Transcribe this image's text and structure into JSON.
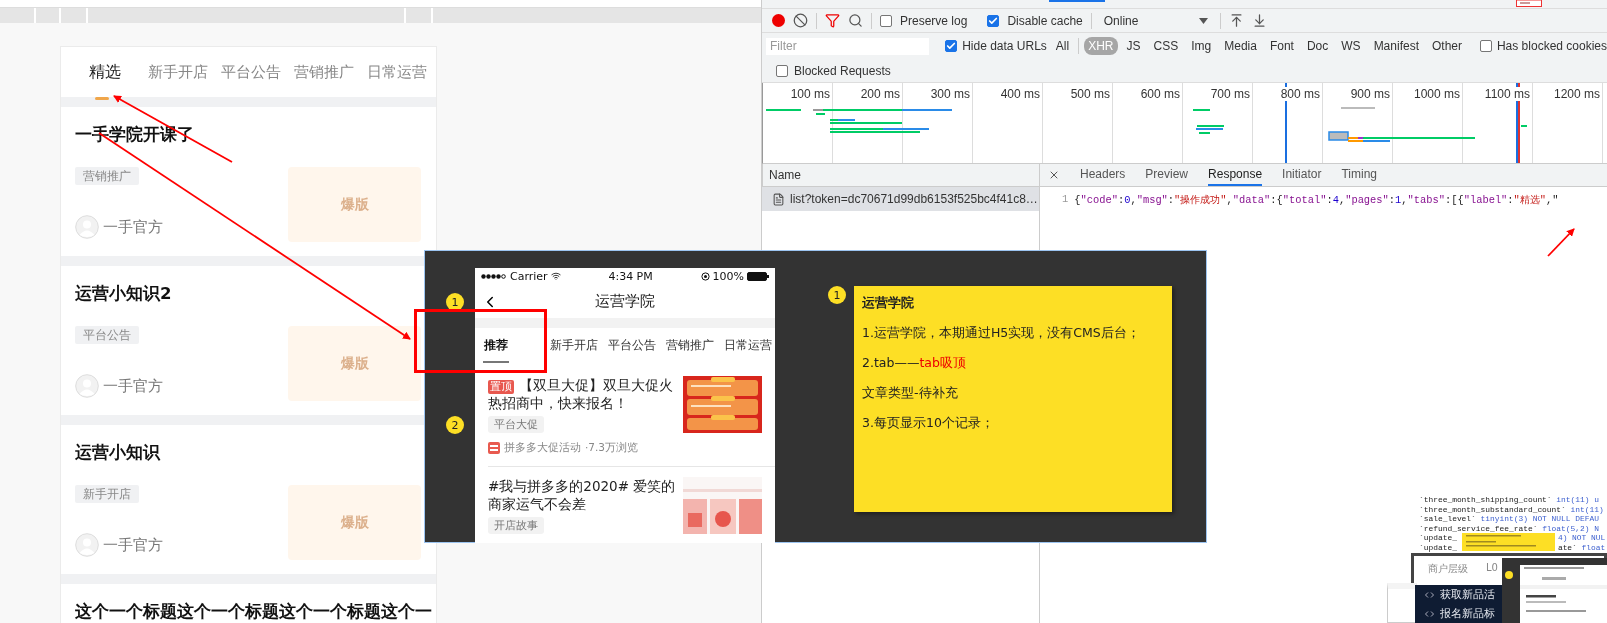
{
  "page": {
    "tabs": [
      {
        "label": "精选",
        "selected": true
      },
      {
        "label": "新手开店",
        "selected": false
      },
      {
        "label": "平台公告",
        "selected": false
      },
      {
        "label": "营销推广",
        "selected": false
      },
      {
        "label": "日常运营",
        "selected": false
      }
    ],
    "articles": [
      {
        "title": "一手学院开课了",
        "tag": "营销推广",
        "author": "一手官方",
        "cover": "爆版"
      },
      {
        "title": "运营小知识2",
        "tag": "平台公告",
        "author": "一手官方",
        "cover": "爆版"
      },
      {
        "title": "运营小知识",
        "tag": "新手开店",
        "author": "一手官方",
        "cover": "爆版"
      },
      {
        "title": "这个一个标题这个一个标题这个一个标题这个一"
      }
    ]
  },
  "devtools": {
    "toolbar": {
      "preserve_log": {
        "label": "Preserve log",
        "checked": false
      },
      "disable_cache": {
        "label": "Disable cache",
        "checked": true
      },
      "throttling": "Online"
    },
    "filter": {
      "placeholder": "Filter",
      "hide_data_urls": {
        "label": "Hide data URLs",
        "checked": true
      },
      "types": [
        {
          "label": "All",
          "selected": false
        },
        {
          "label": "XHR",
          "selected": true
        },
        {
          "label": "JS",
          "selected": false
        },
        {
          "label": "CSS",
          "selected": false
        },
        {
          "label": "Img",
          "selected": false
        },
        {
          "label": "Media",
          "selected": false
        },
        {
          "label": "Font",
          "selected": false
        },
        {
          "label": "Doc",
          "selected": false
        },
        {
          "label": "WS",
          "selected": false
        },
        {
          "label": "Manifest",
          "selected": false
        },
        {
          "label": "Other",
          "selected": false
        }
      ],
      "has_blocked_cookies": {
        "label": "Has blocked cookies",
        "checked": false
      },
      "blocked_requests": {
        "label": "Blocked Requests",
        "checked": false
      }
    },
    "timeline": {
      "ticks": [
        "100 ms",
        "200 ms",
        "300 ms",
        "400 ms",
        "500 ms",
        "600 ms",
        "700 ms",
        "800 ms",
        "900 ms",
        "1000 ms",
        "1100 ms",
        "1200 ms"
      ]
    },
    "requests": {
      "header": "Name",
      "rows": [
        {
          "name": "list?token=dc70671d99db6153f525bc4f41c8…",
          "selected": true
        }
      ]
    },
    "details": {
      "tabs": [
        {
          "label": "Headers",
          "selected": false
        },
        {
          "label": "Preview",
          "selected": false
        },
        {
          "label": "Response",
          "selected": true
        },
        {
          "label": "Initiator",
          "selected": false
        },
        {
          "label": "Timing",
          "selected": false
        }
      ],
      "line_number": "1",
      "code": [
        {
          "kind": "punct",
          "text": "{"
        },
        {
          "kind": "key",
          "text": "\"code\""
        },
        {
          "kind": "punct",
          "text": ":"
        },
        {
          "kind": "number",
          "text": "0"
        },
        {
          "kind": "punct",
          "text": ","
        },
        {
          "kind": "key",
          "text": "\"msg\""
        },
        {
          "kind": "punct",
          "text": ":"
        },
        {
          "kind": "string",
          "text": "\"操作成功\""
        },
        {
          "kind": "punct",
          "text": ","
        },
        {
          "kind": "key",
          "text": "\"data\""
        },
        {
          "kind": "punct",
          "text": ":{"
        },
        {
          "kind": "key",
          "text": "\"total\""
        },
        {
          "kind": "punct",
          "text": ":"
        },
        {
          "kind": "number",
          "text": "4"
        },
        {
          "kind": "punct",
          "text": ","
        },
        {
          "kind": "key",
          "text": "\"pages\""
        },
        {
          "kind": "punct",
          "text": ":"
        },
        {
          "kind": "number",
          "text": "1"
        },
        {
          "kind": "punct",
          "text": ","
        },
        {
          "kind": "key",
          "text": "\"tabs\""
        },
        {
          "kind": "punct",
          "text": ":[{"
        },
        {
          "kind": "key",
          "text": "\"label\""
        },
        {
          "kind": "punct",
          "text": ":"
        },
        {
          "kind": "string",
          "text": "\"精选\""
        },
        {
          "kind": "punct",
          "text": ",\""
        }
      ]
    }
  },
  "overlay": {
    "phone": {
      "carrier": "Carrier",
      "time": "4:34 PM",
      "battery": "100%",
      "title": "运营学院",
      "tabs": [
        {
          "label": "推荐",
          "selected": true
        },
        {
          "label": "新手开店",
          "selected": false
        },
        {
          "label": "平台公告",
          "selected": false
        },
        {
          "label": "营销推广",
          "selected": false
        },
        {
          "label": "日常运营",
          "selected": false
        }
      ],
      "articles": [
        {
          "pin": "置顶",
          "title": "【双旦大促】双旦大促火热招商中，快来报名！",
          "tag": "平台大促",
          "source": "拼多多大促活动",
          "views": "·7.3万浏览"
        },
        {
          "title": "#我与拼多多的2020#  爱笑的商家运气不会差",
          "tag": "开店故事"
        }
      ]
    },
    "markers": [
      "1",
      "2"
    ],
    "note": {
      "marker": "1",
      "title": "运营学院",
      "lines": [
        {
          "text": "1.运营学院，本期通过H5实现，没有CMS后台；"
        },
        {
          "text": "2.tab——",
          "emphasis": "tab吸顶"
        },
        {
          "text": "文章类型-待补充"
        },
        {
          "text": "3.每页显示10个记录；"
        }
      ]
    }
  },
  "background": {
    "sql": [
      {
        "parts": [
          {
            "kind": "name",
            "text": "`three_month_shipping_count`"
          },
          {
            "kind": "type",
            "text": " int(11) u"
          }
        ]
      },
      {
        "parts": [
          {
            "kind": "name",
            "text": "`three_month_substandard_count`"
          },
          {
            "kind": "type",
            "text": " int(11)"
          }
        ]
      },
      {
        "parts": [
          {
            "kind": "name",
            "text": "`sale_level`"
          },
          {
            "kind": "type",
            "text": " tinyint(3) NOT NULL DEFAU"
          }
        ]
      },
      {
        "parts": [
          {
            "kind": "name",
            "text": "`refund_service_fee_rate`"
          },
          {
            "kind": "type",
            "text": " float(5,2) N"
          }
        ]
      },
      {
        "parts": [
          {
            "kind": "name",
            "text": "`update_"
          }
        ],
        "tail": [
          {
            "kind": "type",
            "text": "4) NOT NUL"
          }
        ]
      },
      {
        "parts": [
          {
            "kind": "name",
            "text": "`update_"
          }
        ],
        "tail": [
          {
            "kind": "name",
            "text": "ate`"
          },
          {
            "kind": "type",
            "text": " float"
          }
        ]
      }
    ],
    "table": {
      "label": "商户层级",
      "value": "L0"
    },
    "menu": [
      "获取新品活",
      "报名新品标"
    ]
  }
}
